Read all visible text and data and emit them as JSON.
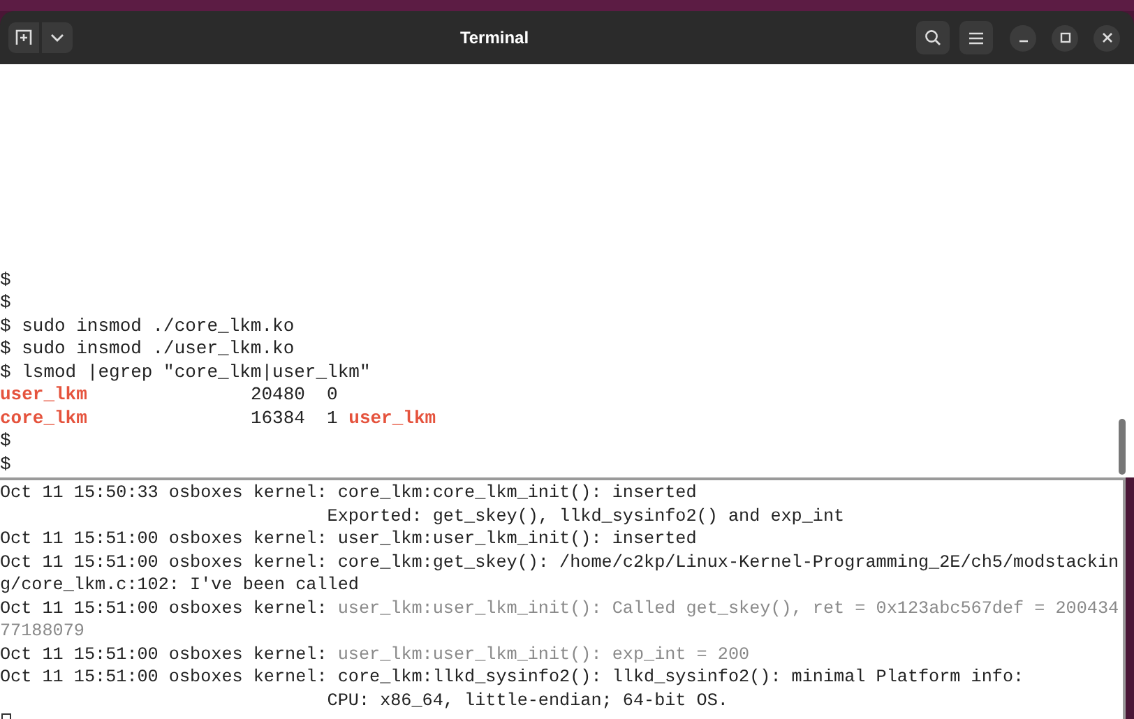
{
  "window": {
    "title": "Terminal"
  },
  "terminal": {
    "lines": [
      {
        "segments": [
          {
            "text": "$",
            "highlight": false
          }
        ]
      },
      {
        "segments": [
          {
            "text": "$",
            "highlight": false
          }
        ]
      },
      {
        "segments": [
          {
            "text": "$ sudo insmod ./core_lkm.ko",
            "highlight": false
          }
        ]
      },
      {
        "segments": [
          {
            "text": "$ sudo insmod ./user_lkm.ko",
            "highlight": false
          }
        ]
      },
      {
        "segments": [
          {
            "text": "$ lsmod |egrep \"core_lkm|user_lkm\"",
            "highlight": false
          }
        ]
      },
      {
        "segments": [
          {
            "text": "user_lkm",
            "highlight": true
          },
          {
            "text": "               20480  0",
            "highlight": false
          }
        ]
      },
      {
        "segments": [
          {
            "text": "core_lkm",
            "highlight": true
          },
          {
            "text": "               16384  1 ",
            "highlight": false
          },
          {
            "text": "user_lkm",
            "highlight": true
          }
        ]
      },
      {
        "segments": [
          {
            "text": "$",
            "highlight": false
          }
        ]
      },
      {
        "segments": [
          {
            "text": "$",
            "highlight": false
          }
        ]
      }
    ]
  },
  "log": {
    "lines": [
      {
        "segments": [
          {
            "text": "Oct 11 15:50:33 osboxes kernel: core_lkm:core_lkm_init(): inserted",
            "dim": false
          }
        ]
      },
      {
        "segments": [
          {
            "text": "                               Exported: get_skey(), llkd_sysinfo2() and exp_int",
            "dim": false
          }
        ]
      },
      {
        "segments": [
          {
            "text": "Oct 11 15:51:00 osboxes kernel: user_lkm:user_lkm_init(): inserted",
            "dim": false
          }
        ]
      },
      {
        "segments": [
          {
            "text": "Oct 11 15:51:00 osboxes kernel: core_lkm:get_skey(): /home/c2kp/Linux-Kernel-Programming_2E/ch5/modstackin",
            "dim": false
          }
        ]
      },
      {
        "segments": [
          {
            "text": "g/core_lkm.c:102: I've been called",
            "dim": false
          }
        ]
      },
      {
        "segments": [
          {
            "text": "Oct 11 15:51:00 osboxes kernel: ",
            "dim": false
          },
          {
            "text": "user_lkm:user_lkm_init(): Called get_skey(), ret = 0x123abc567def = 200434",
            "dim": true
          }
        ]
      },
      {
        "segments": [
          {
            "text": "77188079",
            "dim": true
          }
        ]
      },
      {
        "segments": [
          {
            "text": "Oct 11 15:51:00 osboxes kernel: ",
            "dim": false
          },
          {
            "text": "user_lkm:user_lkm_init(): exp_int = 200",
            "dim": true
          }
        ]
      },
      {
        "segments": [
          {
            "text": "Oct 11 15:51:00 osboxes kernel: core_lkm:llkd_sysinfo2(): llkd_sysinfo2(): minimal Platform info:",
            "dim": false
          }
        ]
      },
      {
        "segments": [
          {
            "text": "                               CPU: x86_64, little-endian; 64-bit OS.",
            "dim": false
          }
        ]
      }
    ]
  }
}
